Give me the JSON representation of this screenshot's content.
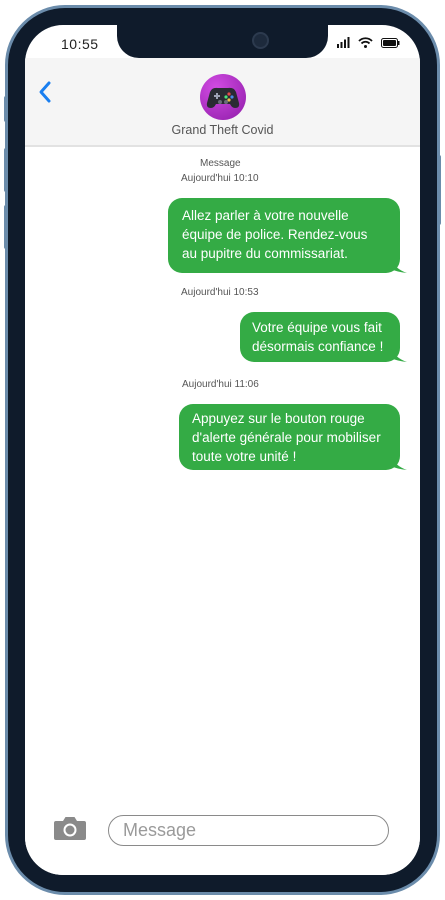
{
  "status_bar": {
    "time": "10:55",
    "icons": [
      "signal-icon",
      "wifi-icon",
      "battery-icon"
    ]
  },
  "header": {
    "contact_name": "Grand Theft Covid",
    "avatar_icon": "gamepad-icon",
    "back_icon": "chevron-left-icon"
  },
  "conversation": {
    "label": "Message",
    "timestamps": [
      "Aujourd'hui 10:10",
      "Aujourd'hui 10:53",
      "Aujourd'hui 11:06"
    ],
    "messages": [
      {
        "text": "Allez parler à votre nouvelle\néquipe de police. Rendez-vous\nau pupitre du commissariat."
      },
      {
        "text": "Votre équipe vous fait\ndésormais confiance !"
      },
      {
        "text": "Appuyez sur le bouton rouge\nd'alerte générale pour mobiliser\ntoute votre unité !"
      }
    ]
  },
  "composer": {
    "placeholder": "Message",
    "camera_icon": "camera-icon"
  },
  "colors": {
    "bubble": "#34ab45",
    "accent": "#1a7ff0",
    "frame": "#0f1b2b"
  }
}
